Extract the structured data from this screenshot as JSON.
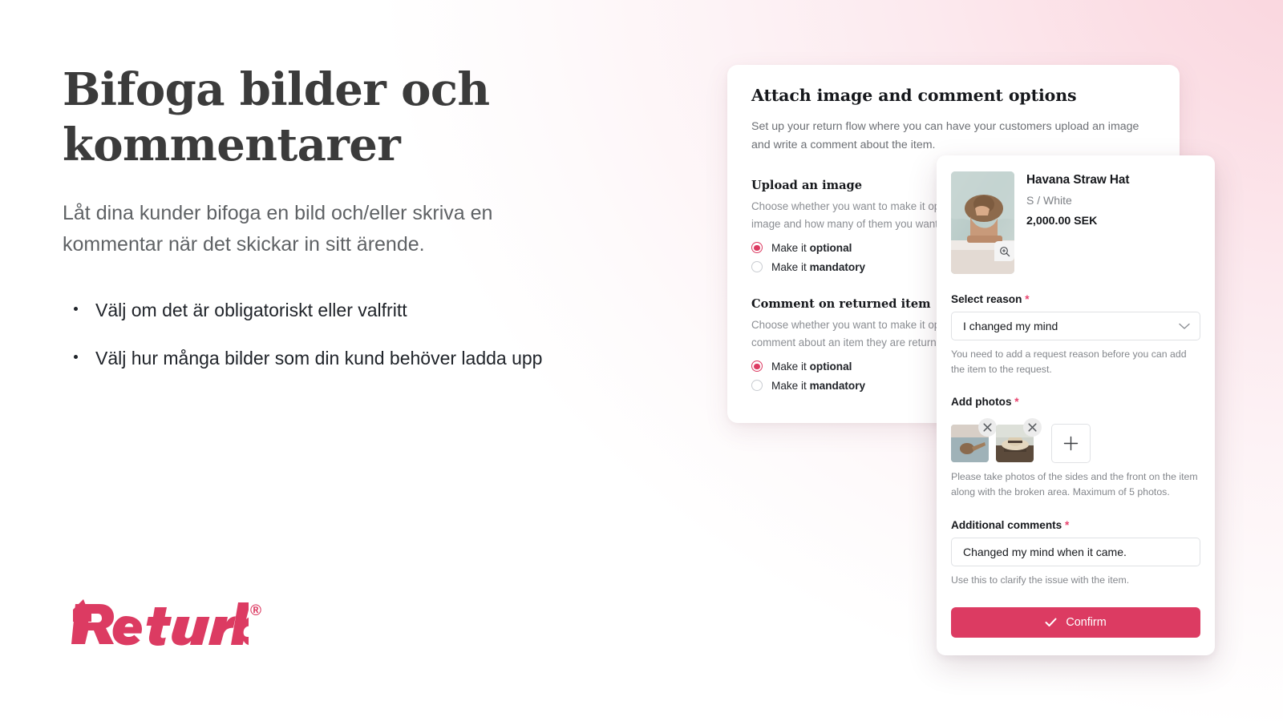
{
  "hero": {
    "title": "Bifoga bilder och kommentarer",
    "subtitle": "Låt dina kunder bifoga en bild och/eller skriva en kommentar när det skickar in sitt ärende.",
    "bullets": [
      "Välj om det är obligatoriskt eller valfritt",
      "Välj hur många bilder som din kund behöver ladda upp"
    ]
  },
  "logo": {
    "name": "Returbo",
    "registered": "®",
    "color": "#dc3b62"
  },
  "back_panel": {
    "title": "Attach image and comment options",
    "description": "Set up your return flow where you can have your customers upload an image and write a comment about the item.",
    "sections": [
      {
        "heading": "Upload an image",
        "description_line1": "Choose whether you want to make it optional or mandatory to upload an",
        "description_line2": "image and how many of them you want to allow.",
        "options": [
          {
            "prefix": "Make it ",
            "strong": "optional",
            "selected": true
          },
          {
            "prefix": "Make it ",
            "strong": "mandatory",
            "selected": false
          }
        ]
      },
      {
        "heading": "Comment on returned item",
        "description_line1": "Choose whether you want to make it optional or mandatory to write a",
        "description_line2": "comment  about an item they are returning.",
        "options": [
          {
            "prefix": "Make it ",
            "strong": "optional",
            "selected": true
          },
          {
            "prefix": "Make it ",
            "strong": "mandatory",
            "selected": false
          }
        ]
      }
    ]
  },
  "front_card": {
    "product": {
      "name": "Havana Straw Hat",
      "variant": "S / White",
      "price": "2,000.00 SEK",
      "zoom_icon": "magnifier-plus-icon"
    },
    "reason": {
      "label": "Select reason",
      "required_marker": "*",
      "selected_value": "I changed my mind",
      "chevron_icon": "chevron-down-icon",
      "help_text": "You need to add a request reason before you can add the item to the request."
    },
    "photos": {
      "label": "Add photos",
      "required_marker": "*",
      "remove_icon": "close-icon",
      "add_icon": "plus-icon",
      "count": 2,
      "help_text": "Please take photos of the sides and the front on the item along with the broken area. Maximum of 5 photos."
    },
    "comments": {
      "label": "Additional comments",
      "required_marker": "*",
      "value": "Changed my mind when it came.",
      "help_text": "Use this to clarify the issue with the item."
    },
    "confirm": {
      "label": "Confirm",
      "icon": "check-icon",
      "color": "#dc3b62"
    }
  }
}
